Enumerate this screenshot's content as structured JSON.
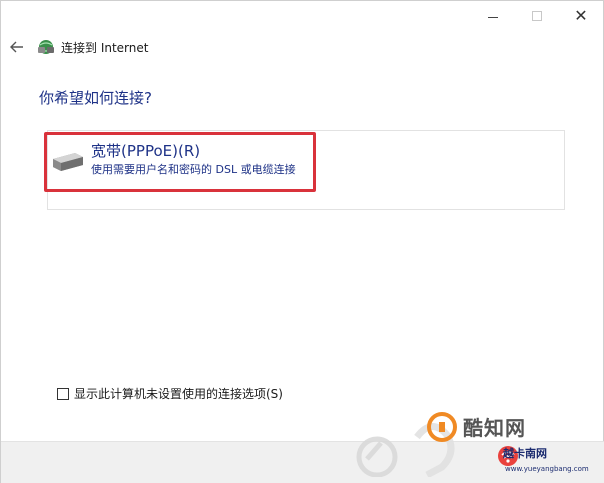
{
  "window": {
    "title": "连接到 Internet",
    "controls": {
      "minimize_icon": "minimize-icon",
      "maximize_icon": "maximize-icon",
      "close_icon": "close-icon"
    }
  },
  "header": {
    "back_icon": "back-arrow-icon",
    "app_icon": "network-globe-icon",
    "title": "连接到 Internet"
  },
  "question": "你希望如何连接?",
  "options": [
    {
      "icon": "modem-icon",
      "title": "宽带(PPPoE)(R)",
      "description": "使用需要用户名和密码的 DSL 或电缆连接",
      "highlighted": true,
      "highlight_color": "#d9323b"
    }
  ],
  "checkbox": {
    "label": "显示此计算机未设置使用的连接选项(S)",
    "checked": false
  },
  "watermark": {
    "brand": "酷知网",
    "brand2": "越卡南网",
    "url": "www.yueyangbang.com"
  },
  "colors": {
    "accent_text": "#1e3287",
    "highlight": "#d9323b",
    "footer_bg": "#f0f0f0"
  }
}
